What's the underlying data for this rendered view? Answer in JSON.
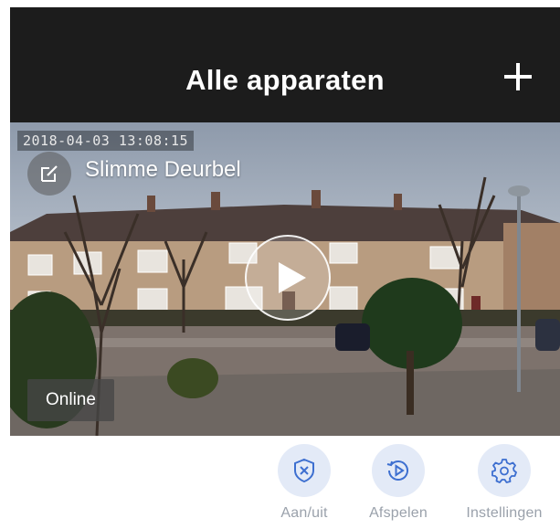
{
  "header": {
    "title": "Alle apparaten",
    "add_icon": "plus-icon"
  },
  "device": {
    "timestamp": "2018-04-03 13:08:15",
    "name": "Slimme Deurbel",
    "status": "Online",
    "edit_icon": "edit-icon",
    "play_icon": "play-icon"
  },
  "actions": [
    {
      "label": "Aan/uit",
      "icon": "shield-x-icon"
    },
    {
      "label": "Afspelen",
      "icon": "replay-icon"
    },
    {
      "label": "Instellingen",
      "icon": "gear-icon"
    }
  ],
  "colors": {
    "header_bg": "#1c1c1c",
    "action_circle": "#e3eaf7",
    "action_icon": "#3d6fd0",
    "action_label": "#9aa1ab"
  }
}
